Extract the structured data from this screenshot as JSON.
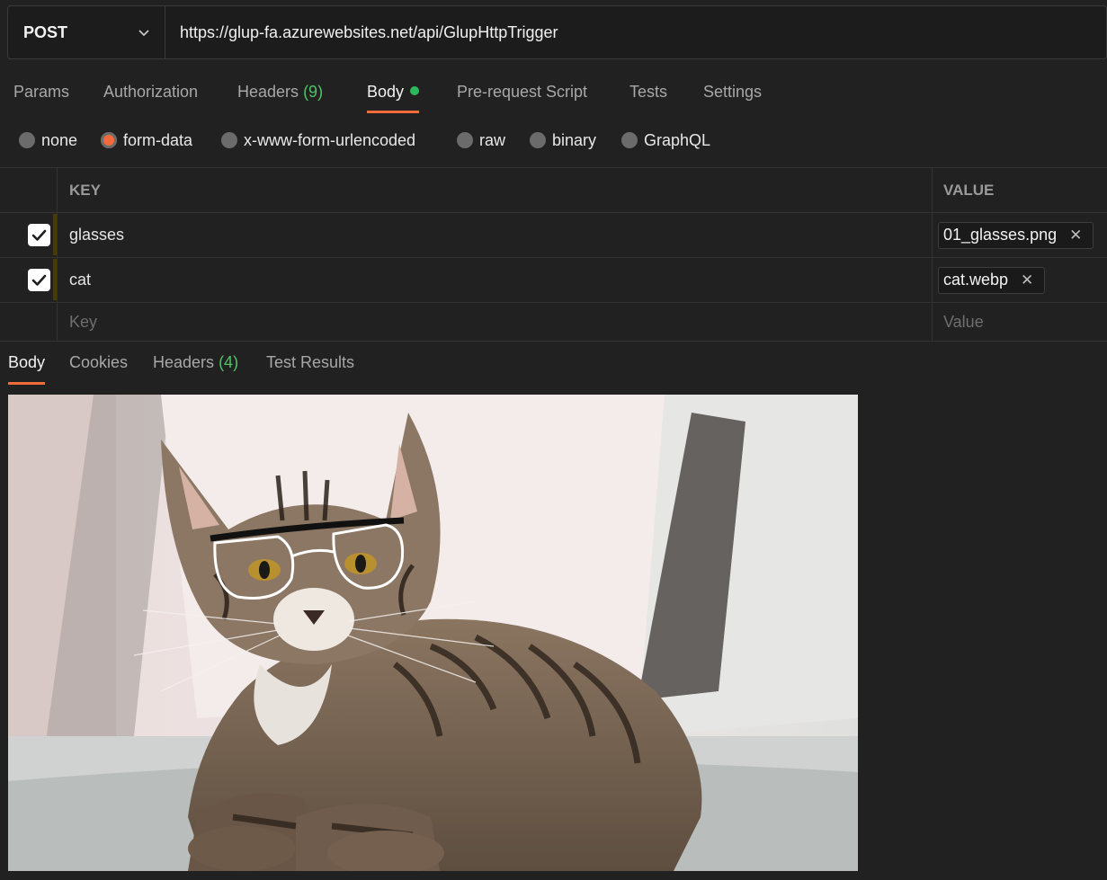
{
  "request": {
    "method": "POST",
    "url": "https://glup-fa.azurewebsites.net/api/GlupHttpTrigger"
  },
  "request_tabs": [
    {
      "label": "Params"
    },
    {
      "label": "Authorization"
    },
    {
      "label": "Headers",
      "count": "(9)"
    },
    {
      "label": "Body",
      "active": true,
      "indicator": "green-dot"
    },
    {
      "label": "Pre-request Script"
    },
    {
      "label": "Tests"
    },
    {
      "label": "Settings"
    }
  ],
  "body_types": [
    {
      "label": "none"
    },
    {
      "label": "form-data",
      "selected": true
    },
    {
      "label": "x-www-form-urlencoded"
    },
    {
      "label": "raw"
    },
    {
      "label": "binary"
    },
    {
      "label": "GraphQL"
    }
  ],
  "form_table": {
    "headers": {
      "key": "KEY",
      "value": "VALUE"
    },
    "rows": [
      {
        "checked": true,
        "key": "glasses",
        "value": "01_glasses.png"
      },
      {
        "checked": true,
        "key": "cat",
        "value": "cat.webp"
      }
    ],
    "placeholders": {
      "key": "Key",
      "value": "Value"
    }
  },
  "response_tabs": [
    {
      "label": "Body",
      "active": true
    },
    {
      "label": "Cookies"
    },
    {
      "label": "Headers",
      "count": "(4)"
    },
    {
      "label": "Test Results"
    }
  ],
  "response_image": {
    "description_icon": "cat-photo-with-glasses"
  },
  "colors": {
    "background": "#212121",
    "accent": "#f26b3a",
    "count_green": "#4ec465",
    "dot_green": "#2eb85c"
  }
}
